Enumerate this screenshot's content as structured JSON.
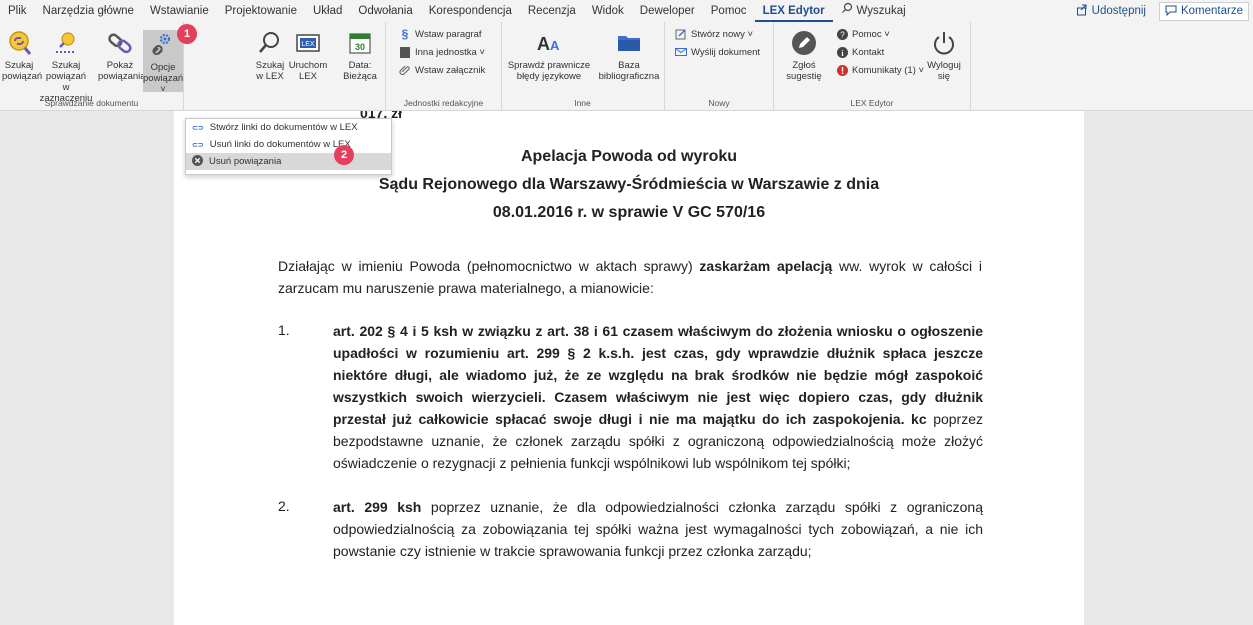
{
  "tabs": [
    "Plik",
    "Narzędzia główne",
    "Wstawianie",
    "Projektowanie",
    "Układ",
    "Odwołania",
    "Korespondencja",
    "Recenzja",
    "Widok",
    "Deweloper",
    "Pomoc",
    "LEX Edytor"
  ],
  "active_tab": "LEX Edytor",
  "search_label": "Wyszukaj",
  "share_label": "Udostępnij",
  "comments_label": "Komentarze",
  "ribbon": {
    "g1": {
      "label": "Sprawdzanie dokumentu",
      "b1": [
        "Szukaj",
        "powiązań"
      ],
      "b2": [
        "Szukaj powiązań",
        "w zaznaczeniu"
      ],
      "b3": [
        "Pokaż",
        "powiązania"
      ],
      "b4": [
        "Opcje",
        "powiązań ˅"
      ]
    },
    "g2": {
      "b1": [
        "Szukaj",
        "w LEX"
      ],
      "b2": [
        "Uruchom",
        "LEX"
      ],
      "b3": [
        "Data:",
        "Bieżąca"
      ]
    },
    "g3": {
      "label": "Jednostki redakcyjne",
      "r1": "Wstaw paragraf",
      "r2": "Inna jednostka ˅",
      "r3": "Wstaw załącznik"
    },
    "g4": {
      "label": "Inne",
      "b1": [
        "Sprawdź prawnicze",
        "błędy językowe"
      ],
      "b2": [
        "Baza",
        "bibliograficzna"
      ]
    },
    "g5": {
      "label": "Nowy",
      "r1": "Stwórz nowy ˅",
      "r2": "Wyślij dokument"
    },
    "g6": {
      "label": "LEX Edytor",
      "b1": [
        "Zgłoś",
        "sugestię"
      ],
      "r1": "Pomoc ˅",
      "r2": "Kontakt",
      "r3": "Komunikaty (1) ˅",
      "b2": [
        "Wyloguj",
        "się"
      ],
      "date_icon": "30",
      "lex_icon": "LEX"
    }
  },
  "dropdown": {
    "items": [
      "Stwórz linki do dokumentów w LEX",
      "Usuń linki do dokumentów w LEX",
      "Usuń powiązania"
    ]
  },
  "badges": [
    "1",
    "2"
  ],
  "document": {
    "cut_text": "017, zł",
    "title1": "Apelacja Powoda od wyroku",
    "title2": "Sądu Rejonowego dla Warszawy-Śródmieścia w Warszawie z dnia",
    "title3": "08.01.2016 r.  w sprawie V GC 570/16",
    "intro_a": "Działając w imieniu Powoda (pełnomocnictwo w aktach sprawy) ",
    "intro_b": "zaskarżam apelacją",
    "intro_c": " ww. wyrok w całości i zarzucam mu naruszenie prawa materialnego, a mianowicie:",
    "item1_num": "1.",
    "item1_bold": "art. 202 § 4 i 5 ksh w związku z art. 38 i 61 czasem właściwym do złożenia wniosku o ogłoszenie upadłości w rozumieniu art. 299 § 2 k.s.h. jest czas, gdy wprawdzie dłużnik spłaca jeszcze niektóre długi, ale wiadomo już, że ze względu na brak środków nie będzie mógł zaspokoić wszystkich swoich wierzycieli. Czasem właściwym nie jest więc dopiero czas, gdy dłużnik przestał już całkowicie spłacać swoje długi i nie ma majątku do ich zaspokojenia. kc",
    "item1_rest": " poprzez bezpodstawne uznanie, że członek zarządu spółki z ograniczoną odpowiedzialnością może złożyć oświadczenie o rezygnacji z pełnienia funkcji wspólnikowi lub wspólnikom tej spółki;",
    "item2_num": "2.",
    "item2_bold": "art. 299 ksh",
    "item2_rest": " poprzez uznanie, że dla odpowiedzialności członka zarządu spółki z ograniczoną odpowiedzialnością za zobowiązania tej spółki ważna jest wymagalności tych zobowiązań, a nie ich powstanie czy istnienie w trakcie sprawowania funkcji przez członka zarządu;"
  }
}
